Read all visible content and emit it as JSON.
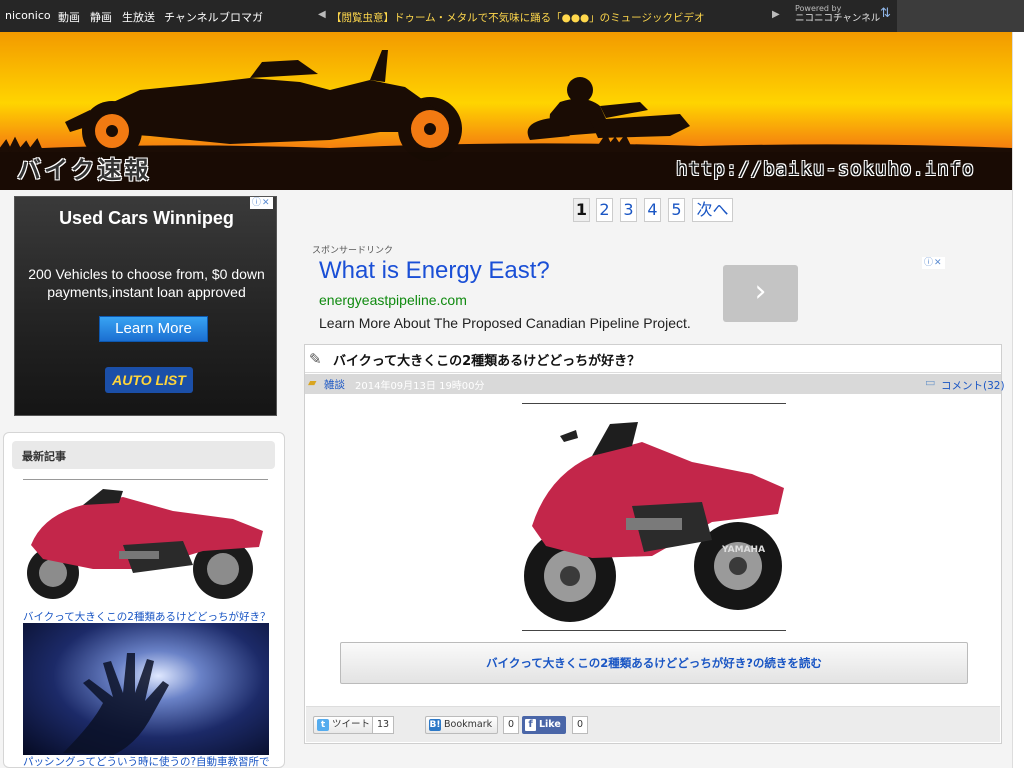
{
  "nicobar": {
    "nav": [
      "niconico",
      "動画",
      "静画",
      "生放送",
      "チャンネル",
      "ブロマガ"
    ],
    "ticker": "【閲覧虫意】ドゥーム・メタルで不気味に踊る「●●●」のミュージックビデオ",
    "powered_by": "Powered by",
    "powered_logo": "ニコニコチャンネル",
    "prev_icon": "triangle-left",
    "next_icon": "triangle-right"
  },
  "banner": {
    "title": "バイク速報",
    "url": "http://baiku-sokuho.info",
    "colors": {
      "sky_top": "#f7a600",
      "sky_mid": "#ffd400",
      "sky_bottom": "#e23a10"
    }
  },
  "left_ad": {
    "title": "Used Cars Winnipeg",
    "description": "200 Vehicles to choose from, $0 down payments,instant loan approved",
    "button": "Learn More",
    "logo": "AUTO LIST"
  },
  "recent": {
    "header": "最新記事",
    "items": [
      {
        "caption": "バイクって大きくこの2種類あるけどどっちが好き？"
      },
      {
        "caption": "パッシングってどういう時に使うの?自動車教習所で"
      }
    ]
  },
  "pager": {
    "pages": [
      "1",
      "2",
      "3",
      "4",
      "5"
    ],
    "next": "次へ",
    "current": "1"
  },
  "sponsor": {
    "label": "スポンサードリンク",
    "headline": "What is Energy East?",
    "domain": "energyeastpipeline.com",
    "description": "Learn More About The Proposed Canadian Pipeline Project."
  },
  "article": {
    "title": "バイクって大きくこの2種類あるけどどっちが好き？",
    "category": "雑談",
    "date": "2014年09月13日 19時00分",
    "comments": "コメント(32)",
    "read_more": "バイクって大きくこの2種類あるけどどっちが好き?の続きを読む",
    "share": {
      "tweet_label": "ツイート",
      "tweet_count": "13",
      "bookmark_label": "Bookmark",
      "bookmark_count": "0",
      "like_label": "Like",
      "like_count": "0"
    }
  },
  "colors": {
    "link": "#1a56c4",
    "facebook": "#4a66a8",
    "ad_headline": "#1a4fd6",
    "ad_domain": "#0f8a0f"
  }
}
